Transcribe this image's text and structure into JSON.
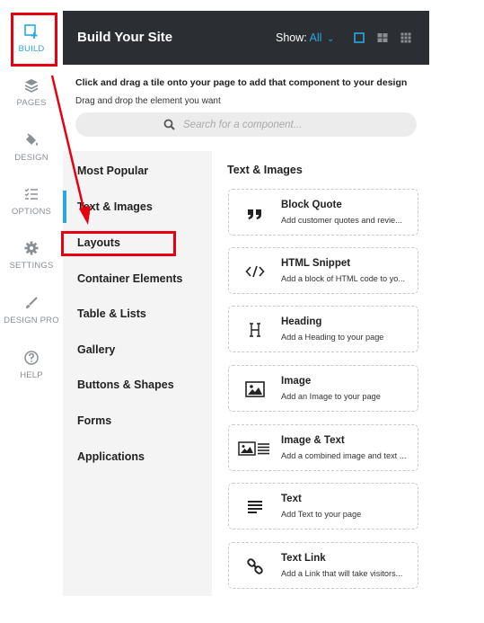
{
  "rail": {
    "items": [
      {
        "label": "BUILD",
        "icon": "build-icon",
        "active": true
      },
      {
        "label": "PAGES",
        "icon": "pages-icon"
      },
      {
        "label": "DESIGN",
        "icon": "design-icon"
      },
      {
        "label": "OPTIONS",
        "icon": "options-icon"
      },
      {
        "label": "SETTINGS",
        "icon": "settings-icon"
      },
      {
        "label": "DESIGN PRO",
        "icon": "design-pro-icon"
      },
      {
        "label": "HELP",
        "icon": "help-icon"
      }
    ]
  },
  "header": {
    "title": "Build Your Site",
    "show_label": "Show:",
    "show_value": "All"
  },
  "instructions": {
    "line1": "Click and drag a tile onto your page to add that component to your design",
    "line2": "Drag and drop the element you want"
  },
  "search": {
    "placeholder": "Search for a component..."
  },
  "categories": [
    {
      "label": "Most Popular"
    },
    {
      "label": "Text & Images",
      "active": true
    },
    {
      "label": "Layouts"
    },
    {
      "label": "Container Elements"
    },
    {
      "label": "Table & Lists"
    },
    {
      "label": "Gallery"
    },
    {
      "label": "Buttons & Shapes"
    },
    {
      "label": "Forms"
    },
    {
      "label": "Applications"
    }
  ],
  "content": {
    "title": "Text & Images",
    "tiles": [
      {
        "name": "Block Quote",
        "desc": "Add customer quotes and revie...",
        "icon": "quote-icon"
      },
      {
        "name": "HTML Snippet",
        "desc": "Add a block of HTML code to yo...",
        "icon": "code-icon"
      },
      {
        "name": "Heading",
        "desc": "Add a Heading to your page",
        "icon": "heading-icon"
      },
      {
        "name": "Image",
        "desc": "Add an Image to your page",
        "icon": "image-icon"
      },
      {
        "name": "Image & Text",
        "desc": "Add a combined image and text ...",
        "icon": "image-text-icon"
      },
      {
        "name": "Text",
        "desc": "Add Text to your page",
        "icon": "text-icon"
      },
      {
        "name": "Text Link",
        "desc": "Add a Link that will take visitors...",
        "icon": "link-icon"
      }
    ]
  },
  "colors": {
    "accent": "#29a8e0",
    "header_bg": "#2b2e33",
    "annotation_red": "#e60012"
  }
}
